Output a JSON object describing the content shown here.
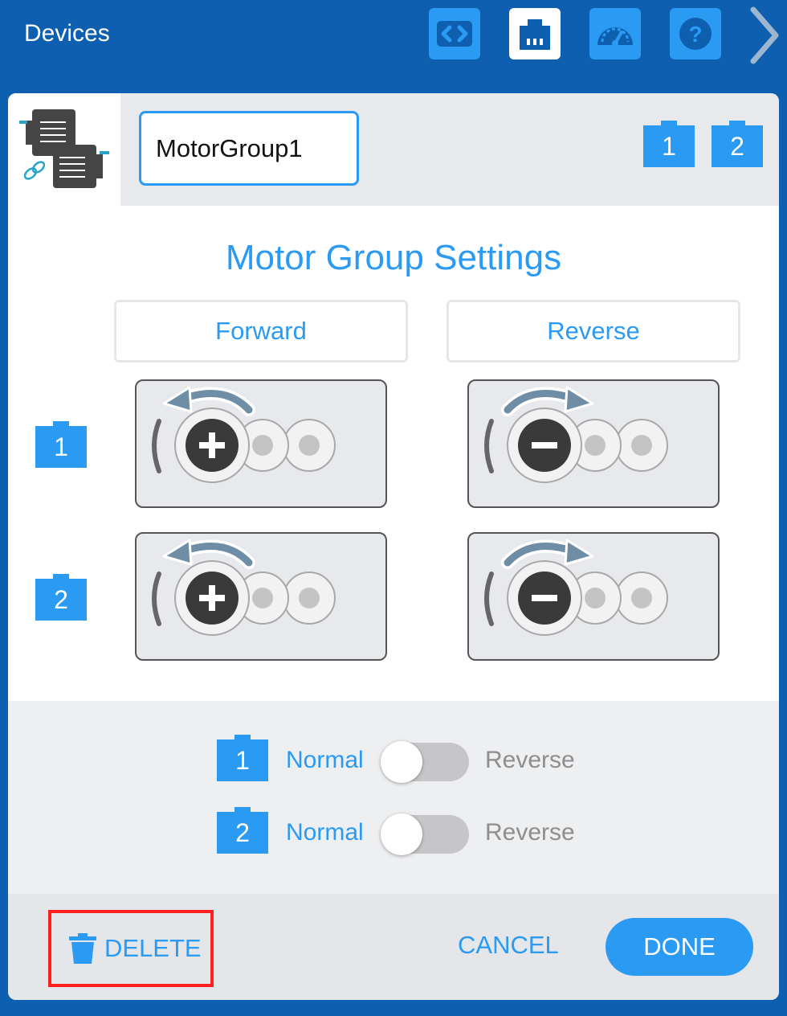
{
  "topbar": {
    "title": "Devices",
    "tools": [
      {
        "icon": "code-icon",
        "active": false
      },
      {
        "icon": "brain-port-icon",
        "active": true
      },
      {
        "icon": "dashboard-gauge-icon",
        "active": false
      },
      {
        "icon": "help-icon",
        "active": false
      }
    ],
    "next_icon": "chevron-right-icon"
  },
  "colors": {
    "brand_blue": "#0e5fb0",
    "accent_blue": "#2b9af3",
    "highlight_red": "#ff2020",
    "motor_dark": "#3a3a3a"
  },
  "header": {
    "group_icon": "motor-group-icon",
    "name_value": "MotorGroup1",
    "ports": [
      "1",
      "2"
    ]
  },
  "settings": {
    "title": "Motor Group Settings",
    "forward_label": "Forward",
    "reverse_label": "Reverse",
    "rows": [
      {
        "port": "1"
      },
      {
        "port": "2"
      }
    ]
  },
  "direction": {
    "rows": [
      {
        "port": "1",
        "normal_label": "Normal",
        "reverse_label": "Reverse",
        "reversed": false
      },
      {
        "port": "2",
        "normal_label": "Normal",
        "reverse_label": "Reverse",
        "reversed": false
      }
    ]
  },
  "footer": {
    "delete_label": "DELETE",
    "cancel_label": "CANCEL",
    "done_label": "DONE"
  }
}
